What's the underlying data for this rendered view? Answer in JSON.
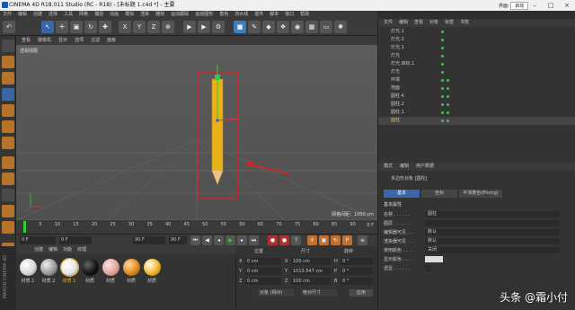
{
  "window": {
    "title": "CINEMA 4D R18.011 Studio (RC - R18) - [未标题 1.c4d *] - 主要",
    "layout_label": "界面:",
    "layout_value": "启动"
  },
  "menubar": [
    "文件",
    "编辑",
    "创建",
    "选择",
    "工具",
    "网格",
    "捕捉",
    "动画",
    "模拟",
    "渲染",
    "雕刻",
    "运动跟踪",
    "运动图形",
    "角色",
    "流水线",
    "插件",
    "脚本",
    "窗口",
    "帮助"
  ],
  "viewport": {
    "menu": [
      "查看",
      "摄像机",
      "显示",
      "选项",
      "过滤",
      "面板"
    ],
    "label": "透视视图",
    "grid_info": "网格间距：1000 cm"
  },
  "timeline": {
    "ticks": [
      "0",
      "5",
      "10",
      "15",
      "20",
      "25",
      "30",
      "35",
      "40",
      "45",
      "50",
      "55",
      "60",
      "65",
      "70",
      "75",
      "80",
      "85",
      "90"
    ],
    "end_label": "0 F"
  },
  "transport": {
    "start_frame": "0 F",
    "current_frame": "0 F",
    "end_frame": "90 F",
    "end_frame2": "90 F"
  },
  "materials": {
    "menu": [
      "创建",
      "编辑",
      "功能",
      "纹理"
    ],
    "items": [
      {
        "label": "材质.1",
        "color": "#d8d8d8"
      },
      {
        "label": "材质.2",
        "color": "#9a9a9a"
      },
      {
        "label": "材质.1",
        "color": "#e6e6e6"
      },
      {
        "label": "材质",
        "color": "#151515"
      },
      {
        "label": "材质",
        "color": "#e3a69a"
      },
      {
        "label": "材质",
        "color": "#e08a20"
      },
      {
        "label": "材质",
        "color": "#f0b830"
      }
    ]
  },
  "coords": {
    "headers": [
      "位置",
      "尺寸",
      "旋转"
    ],
    "rows": [
      {
        "axis": "X",
        "pos": "0 cm",
        "size": "100 cm",
        "rot_axis": "H",
        "rot": "0 °"
      },
      {
        "axis": "Y",
        "pos": "0 cm",
        "size": "1013.547 cm",
        "rot_axis": "P",
        "rot": "0 °"
      },
      {
        "axis": "Z",
        "pos": "0 cm",
        "size": "100 cm",
        "rot_axis": "B",
        "rot": "0 °"
      }
    ],
    "mode": "对象 (相对)",
    "size_mode": "绝对尺寸",
    "apply": "应用"
  },
  "objects": {
    "menu": [
      "文件",
      "编辑",
      "查看",
      "对象",
      "标签",
      "书签"
    ],
    "rows": [
      "灯光.1",
      "灯光.2",
      "灯光.1",
      "灯光",
      "灯光.目标.1",
      "灯光",
      "环境",
      "地面",
      "圆柱.4",
      "圆柱.2",
      "圆柱.1",
      "圆柱"
    ]
  },
  "attributes": {
    "menu": [
      "模式",
      "编辑",
      "用户数据"
    ],
    "object_title": "多边形对象 [圆柱]",
    "tabs": [
      "基本",
      "坐标",
      "平滑着色(Phong)"
    ],
    "section": "基本属性",
    "rows": [
      {
        "label": "名称 . . . . . .",
        "value": "圆柱"
      },
      {
        "label": "图层 . . . . . .",
        "value": ""
      },
      {
        "label": "编辑器可见 . . .",
        "value": "默认"
      },
      {
        "label": "渲染器可见 . . .",
        "value": "默认"
      },
      {
        "label": "使用颜色 . . . .",
        "value": "关闭"
      },
      {
        "label": "显示颜色 . . . .",
        "value": ""
      },
      {
        "label": "透显 . . . . . .",
        "value": ""
      }
    ]
  },
  "watermark": "头条 @霜小付"
}
